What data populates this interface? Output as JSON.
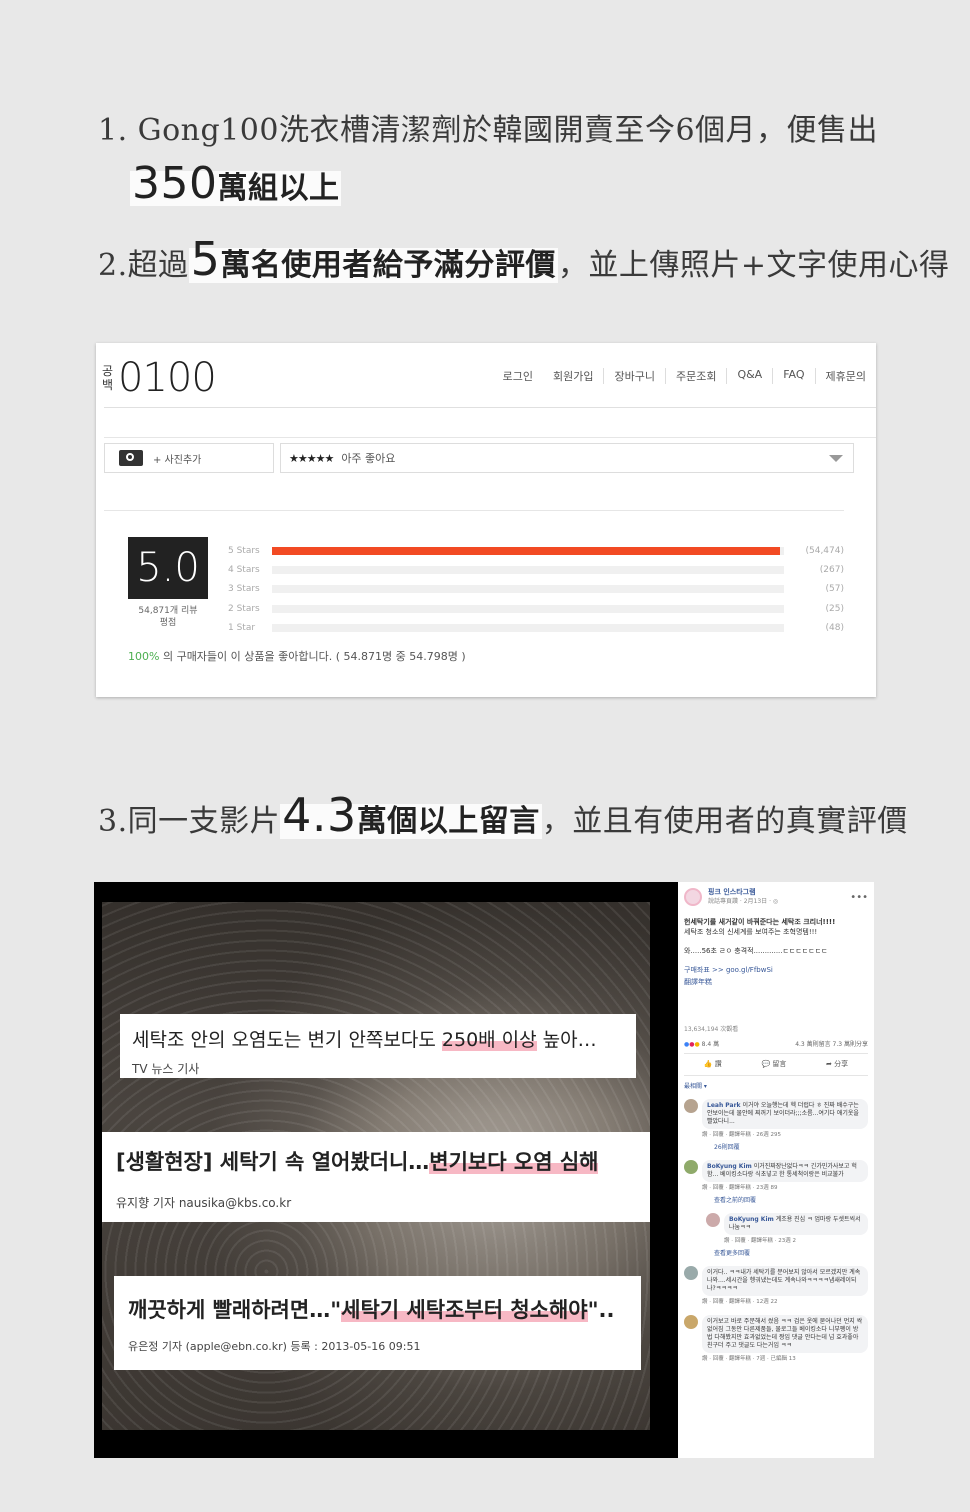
{
  "headlines": {
    "h1_text": "1. Gong100洗衣槽清潔劑於韓國開賣至今6個月，便售出",
    "h1_highlight_num": "350",
    "h1_highlight_rest": "萬組以上",
    "h2_prefix": "2.超過",
    "h2_num": "5",
    "h2_highlight": "萬名使用者給予滿分評價",
    "h2_suffix": "，並上傳照片+文字使用心得",
    "h3_prefix": "3.同一支影片",
    "h3_num": "4.3",
    "h3_highlight": "萬個以上留言",
    "h3_suffix": "，並且有使用者的真實評價"
  },
  "shop": {
    "logo_kor_top": "공",
    "logo_kor_bottom": "백",
    "logo_num": "0100",
    "nav": [
      "로그인",
      "회원가입",
      "장바구니",
      "주문조회",
      "Q&A",
      "FAQ",
      "제휴문의"
    ],
    "photo_add": "+ 사진추가",
    "select_stars": "★★★★★",
    "select_label": "아주 좋아요",
    "score": "5.0",
    "score_label_1": "54,871개 리뷰",
    "score_label_2": "평점",
    "bars": [
      {
        "label": "5 Stars",
        "count": "(54,474)",
        "fraction": 0.993
      },
      {
        "label": "4 Stars",
        "count": "(267)",
        "fraction": 0
      },
      {
        "label": "3 Stars",
        "count": "(57)",
        "fraction": 0
      },
      {
        "label": "2 Stars",
        "count": "(25)",
        "fraction": 0
      },
      {
        "label": "1 Star",
        "count": "(48)",
        "fraction": 0
      }
    ],
    "pct": "100%",
    "pct_text": "의 구매자들이 이 상품을 좋아합니다. ( 54.871명 중 54.798명 )"
  },
  "video": {
    "news1_title_a": "세탁조 안의 오염도는 변기 안쪽보다도 ",
    "news1_title_mark": "250배 이상",
    "news1_title_b": " 높아…",
    "news1_sub": "TV 뉴스 기사",
    "news2_title_a": "[생활현장] 세탁기 속 열어봤더니…",
    "news2_title_mark": "변기보다 오염 심해",
    "news2_sub": "유지향 기자 nausika@kbs.co.kr",
    "news3_title_a": "깨끗하게 빨래하려면…\"",
    "news3_title_mark": "세탁기 세탁조부터 청소해야",
    "news3_title_b": "\"..",
    "news3_sub": "유은정 기자 (apple@ebn.co.kr) 등록 : 2013-05-16 09:51"
  },
  "fb": {
    "page_name": "핑크 인스타그램",
    "page_sub": "說話專頁讚 · 2月13日 · ◎",
    "post_line1": "헌세탁기를 새거같이 바꿔준다는 세탁조 크리너!!!!",
    "post_line2": "세탁조 청소의 신세계를 보여주는 초혁명템!!!",
    "post_line3": "와.....56초 ㄹㅇ 충격적.............ㄷㄷㄷㄷㄷㄷㄷ",
    "post_line4": "구매좌표 >> goo.gl/FfbwSi",
    "post_line5": "翻譯年糕",
    "views": "13,634,194 次觀看",
    "reacts": "8.4 萬",
    "react_right": "4.3 萬則留言 7.3 萬則分享",
    "act_like": "讚",
    "act_comment": "留言",
    "act_share": "分享",
    "sort": "最相關 ▾",
    "comments": [
      {
        "name": "Leah Park",
        "text": "이거야 오늘행는데 헥 더럽다 ㅎ 진짜 배수구는 안보이는데 물안에 찌꺼기 보이더라;;;소름...여기다 애기옷을 빨았다니...",
        "meta": "讚 · 回覆 · 翻譯年糕 · 26週   295"
      },
      {
        "name": "BoKyung Kim",
        "text": "이거진짜장난없다ㅋㅋ 긴가민가사보고 헉함... 베이킹소다랑 식초넣고 한 통세척이랑은 비교불가",
        "meta": "讚 · 回覆 · 翻譯年糕 · 23週   89"
      },
      {
        "name": "BoKyung Kim",
        "text": "계조용 진심 ㅋ 엄마랑 두셋트씩서 나눔ㅋㅋ",
        "meta": "讚 · 回覆 · 翻譯年糕 · 23週   2"
      },
      {
        "name": "",
        "text": "이거다.. ㅋㅋ내가 세탁기를 분어보지 않아서 모르겠지만 계속나와....세시간을 헹궈냈는데도 계속나와ㅋㅋㅋㅋ냄새레이되나?ㅋㅋㅋㅋ",
        "meta": "讚 · 回覆 · 翻譯年糕 · 12週   22"
      },
      {
        "name": "",
        "text": "이거보고 바로 주문해서 썼음 ㅋㅋ 검은 옷에 묻어나던 먼지 싹없어짐 그동안 다른제품들, 물로그들 베이킹소다 니부펭이 방법 다해봤지만 효과없었는데 짱임 댓글 안다는데 넘 효과좋아 친구더 주고 댓글도 다는거임 ㅋㅋ",
        "meta": "讚 · 回覆 · 翻譯年糕 · 7週 · 已編輯   13"
      }
    ],
    "more1": "26則回覆",
    "more2": "查看之前的回覆",
    "more3": "查看更多回覆"
  }
}
